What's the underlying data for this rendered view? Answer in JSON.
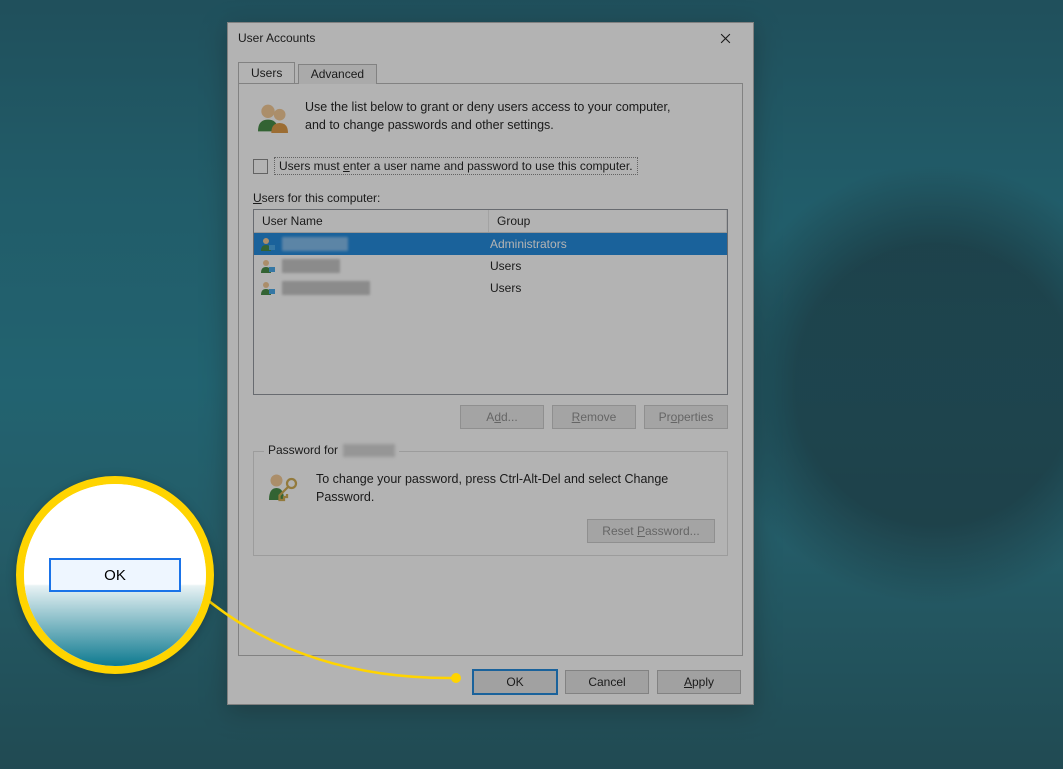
{
  "dialog": {
    "title": "User Accounts",
    "tabs": {
      "users": "Users",
      "advanced": "Advanced"
    },
    "intro": "Use the list below to grant or deny users access to your computer, and to change passwords and other settings.",
    "checkbox": {
      "pre": "Users must ",
      "u": "e",
      "post": "nter a user name and password to use this computer."
    },
    "list_label": {
      "u": "U",
      "rest": "sers for this computer:"
    },
    "table": {
      "headers": {
        "c1": "User Name",
        "c2": "Group"
      },
      "rows": [
        {
          "username": "",
          "group": "Administrators",
          "selected": true
        },
        {
          "username": "",
          "group": "Users",
          "selected": false
        },
        {
          "username": "",
          "group": "Users",
          "selected": false
        }
      ]
    },
    "buttons": {
      "add": {
        "u": "d",
        "pre": "A",
        "post": "d..."
      },
      "remove": {
        "u": "R",
        "post": "emove"
      },
      "properties": {
        "u": "o",
        "pre": "Pr",
        "post": "perties"
      }
    },
    "password_group": {
      "legend_label": "Password for ",
      "legend_user": "",
      "text": "To change your password, press Ctrl-Alt-Del and select Change Password.",
      "reset": {
        "pre": "Reset ",
        "u": "P",
        "post": "assword..."
      }
    },
    "footer": {
      "ok": "OK",
      "cancel": "Cancel",
      "apply": {
        "u": "A",
        "post": "pply"
      }
    }
  },
  "callout": {
    "ok": "OK"
  }
}
